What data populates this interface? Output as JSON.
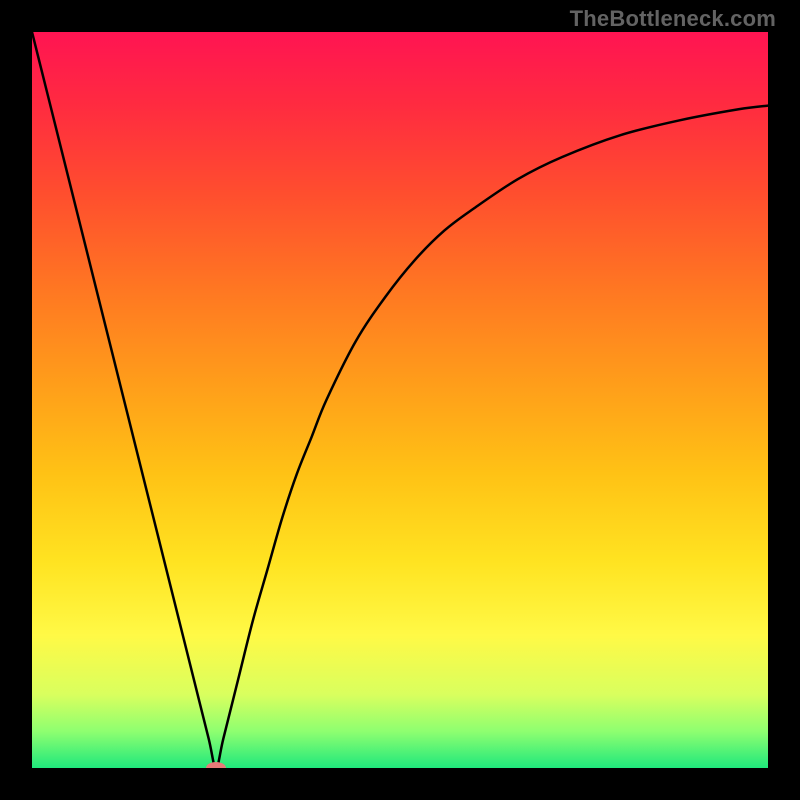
{
  "watermark": "TheBottleneck.com",
  "colors": {
    "black": "#000000",
    "curve": "#000000",
    "marker": "#e77b79",
    "gradient_stops": [
      {
        "offset": 0.0,
        "color": "#ff1452"
      },
      {
        "offset": 0.1,
        "color": "#ff2b40"
      },
      {
        "offset": 0.22,
        "color": "#ff4e2e"
      },
      {
        "offset": 0.35,
        "color": "#ff7722"
      },
      {
        "offset": 0.48,
        "color": "#ff9e1a"
      },
      {
        "offset": 0.6,
        "color": "#ffc215"
      },
      {
        "offset": 0.72,
        "color": "#ffe321"
      },
      {
        "offset": 0.82,
        "color": "#fff946"
      },
      {
        "offset": 0.9,
        "color": "#d9ff5e"
      },
      {
        "offset": 0.95,
        "color": "#8fff70"
      },
      {
        "offset": 1.0,
        "color": "#1fe87c"
      }
    ]
  },
  "chart_data": {
    "type": "line",
    "title": "",
    "xlabel": "",
    "ylabel": "",
    "xlim": [
      0,
      100
    ],
    "ylim": [
      0,
      100
    ],
    "grid": false,
    "legend": false,
    "series": [
      {
        "name": "bottleneck-curve",
        "x": [
          0,
          2,
          4,
          6,
          8,
          10,
          12,
          14,
          16,
          18,
          20,
          22,
          24,
          25,
          26,
          28,
          30,
          32,
          34,
          36,
          38,
          40,
          44,
          48,
          52,
          56,
          60,
          66,
          72,
          80,
          88,
          96,
          100
        ],
        "y": [
          100,
          92,
          84,
          76,
          68,
          60,
          52,
          44,
          36,
          28,
          20,
          12,
          4,
          0,
          4,
          12,
          20,
          27,
          34,
          40,
          45,
          50,
          58,
          64,
          69,
          73,
          76,
          80,
          83,
          86,
          88,
          89.5,
          90
        ]
      }
    ],
    "markers": [
      {
        "name": "min-point",
        "x": 25,
        "y": 0
      }
    ],
    "annotations": []
  }
}
